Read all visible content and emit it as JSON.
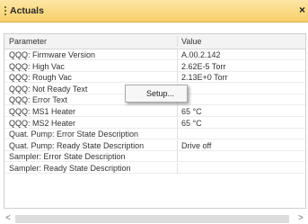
{
  "window": {
    "title": "Actuals",
    "close": "×"
  },
  "table": {
    "columns": [
      "Parameter",
      "Value"
    ],
    "rows": [
      {
        "param": "QQQ: Firmware Version",
        "value": "A.00.2.142"
      },
      {
        "param": "QQQ: High Vac",
        "value": "2.62E-5 Torr"
      },
      {
        "param": "QQQ: Rough Vac",
        "value": "2.13E+0 Torr"
      },
      {
        "param": "QQQ: Not Ready Text",
        "value": ""
      },
      {
        "param": "QQQ: Error Text",
        "value": ""
      },
      {
        "param": "QQQ: MS1 Heater",
        "value": "65 °C"
      },
      {
        "param": "QQQ: MS2 Heater",
        "value": "65 °C"
      },
      {
        "param": "Quat. Pump: Error State Description",
        "value": ""
      },
      {
        "param": "Quat. Pump: Ready State Description",
        "value": "Drive off"
      },
      {
        "param": "Sampler: Error State Description",
        "value": ""
      },
      {
        "param": "Sampler: Ready State Description",
        "value": ""
      }
    ]
  },
  "context_menu": {
    "items": [
      {
        "label": "Setup..."
      }
    ]
  },
  "scrollbar": {
    "left": "<",
    "right": ">"
  }
}
